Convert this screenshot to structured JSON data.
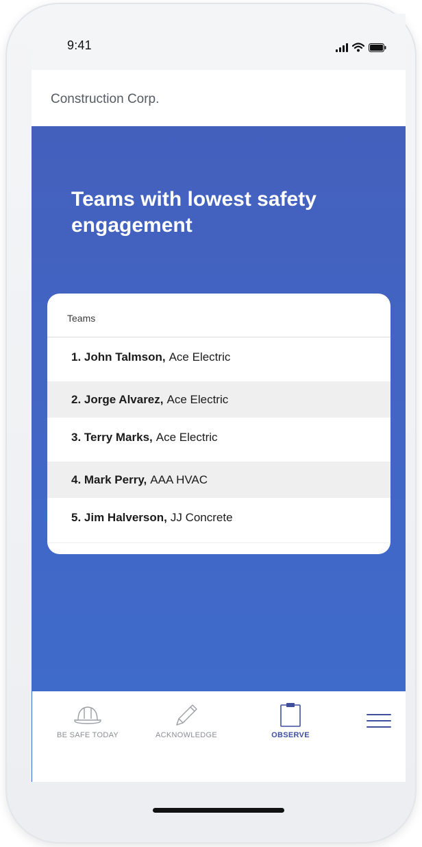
{
  "status_bar": {
    "time": "9:41",
    "icons": [
      "signal-icon",
      "wifi-icon",
      "battery-icon"
    ]
  },
  "header": {
    "company_name": "Construction Corp."
  },
  "hero": {
    "title": "Teams with lowest safety engagement"
  },
  "card": {
    "header": "Teams",
    "rows": [
      {
        "name": "1. John Talmson,",
        "company": "Ace Electric"
      },
      {
        "name": "2. Jorge Alvarez,",
        "company": "Ace Electric"
      },
      {
        "name": "3. Terry Marks,",
        "company": "Ace Electric"
      },
      {
        "name": "4. Mark Perry,",
        "company": "AAA HVAC"
      },
      {
        "name": "5. Jim Halverson,",
        "company": "JJ Concrete"
      }
    ]
  },
  "tabs": [
    {
      "label": "BE SAFE TODAY",
      "icon": "hard-hat-icon",
      "active": false
    },
    {
      "label": "ACKNOWLEDGE",
      "icon": "pencil-icon",
      "active": false
    },
    {
      "label": "OBSERVE",
      "icon": "clipboard-icon",
      "active": true
    }
  ],
  "menu": {
    "icon": "hamburger-menu-icon"
  },
  "colors": {
    "hero_top": "#4460bd",
    "hero_bottom": "#3f6bcb",
    "active_tab": "#3d4f9e",
    "inactive_tab": "#8a8e94",
    "row_shade": "#efefef"
  }
}
